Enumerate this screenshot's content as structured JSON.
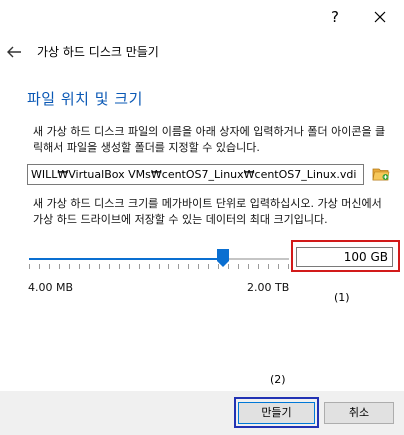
{
  "titlebar": {
    "help_label": "?"
  },
  "header": {
    "title": "가상 하드 디스크 만들기"
  },
  "page": {
    "heading": "파일 위치 및 크기",
    "location_description": "새 가상 하드 디스크 파일의 이름을 아래 상자에 입력하거나 폴더 아이콘을 클릭해서 파일을 생성할 폴더를 지정할 수 있습니다.",
    "location_value": "WILL₩VirtualBox VMs₩centOS7_Linux₩centOS7_Linux.vdi",
    "size_description": "새 가상 하드 디스크 크기를 메가바이트 단위로 입력하십시오. 가상 머신에서 가상 하드 드라이브에 저장할 수 있는 데이터의 최대 크기입니다.",
    "size_value": "100 GB",
    "size_min_label": "4.00 MB",
    "size_max_label": "2.00 TB",
    "slider_fraction": 0.746
  },
  "annotations": {
    "one": "(1)",
    "two": "(2)"
  },
  "footer": {
    "create_label": "만들기",
    "cancel_label": "취소"
  },
  "colors": {
    "heading": "#0a58b5",
    "slider_accent": "#0a6fd1",
    "highlight_red": "#d21a1a",
    "highlight_blue": "#2233b4"
  }
}
